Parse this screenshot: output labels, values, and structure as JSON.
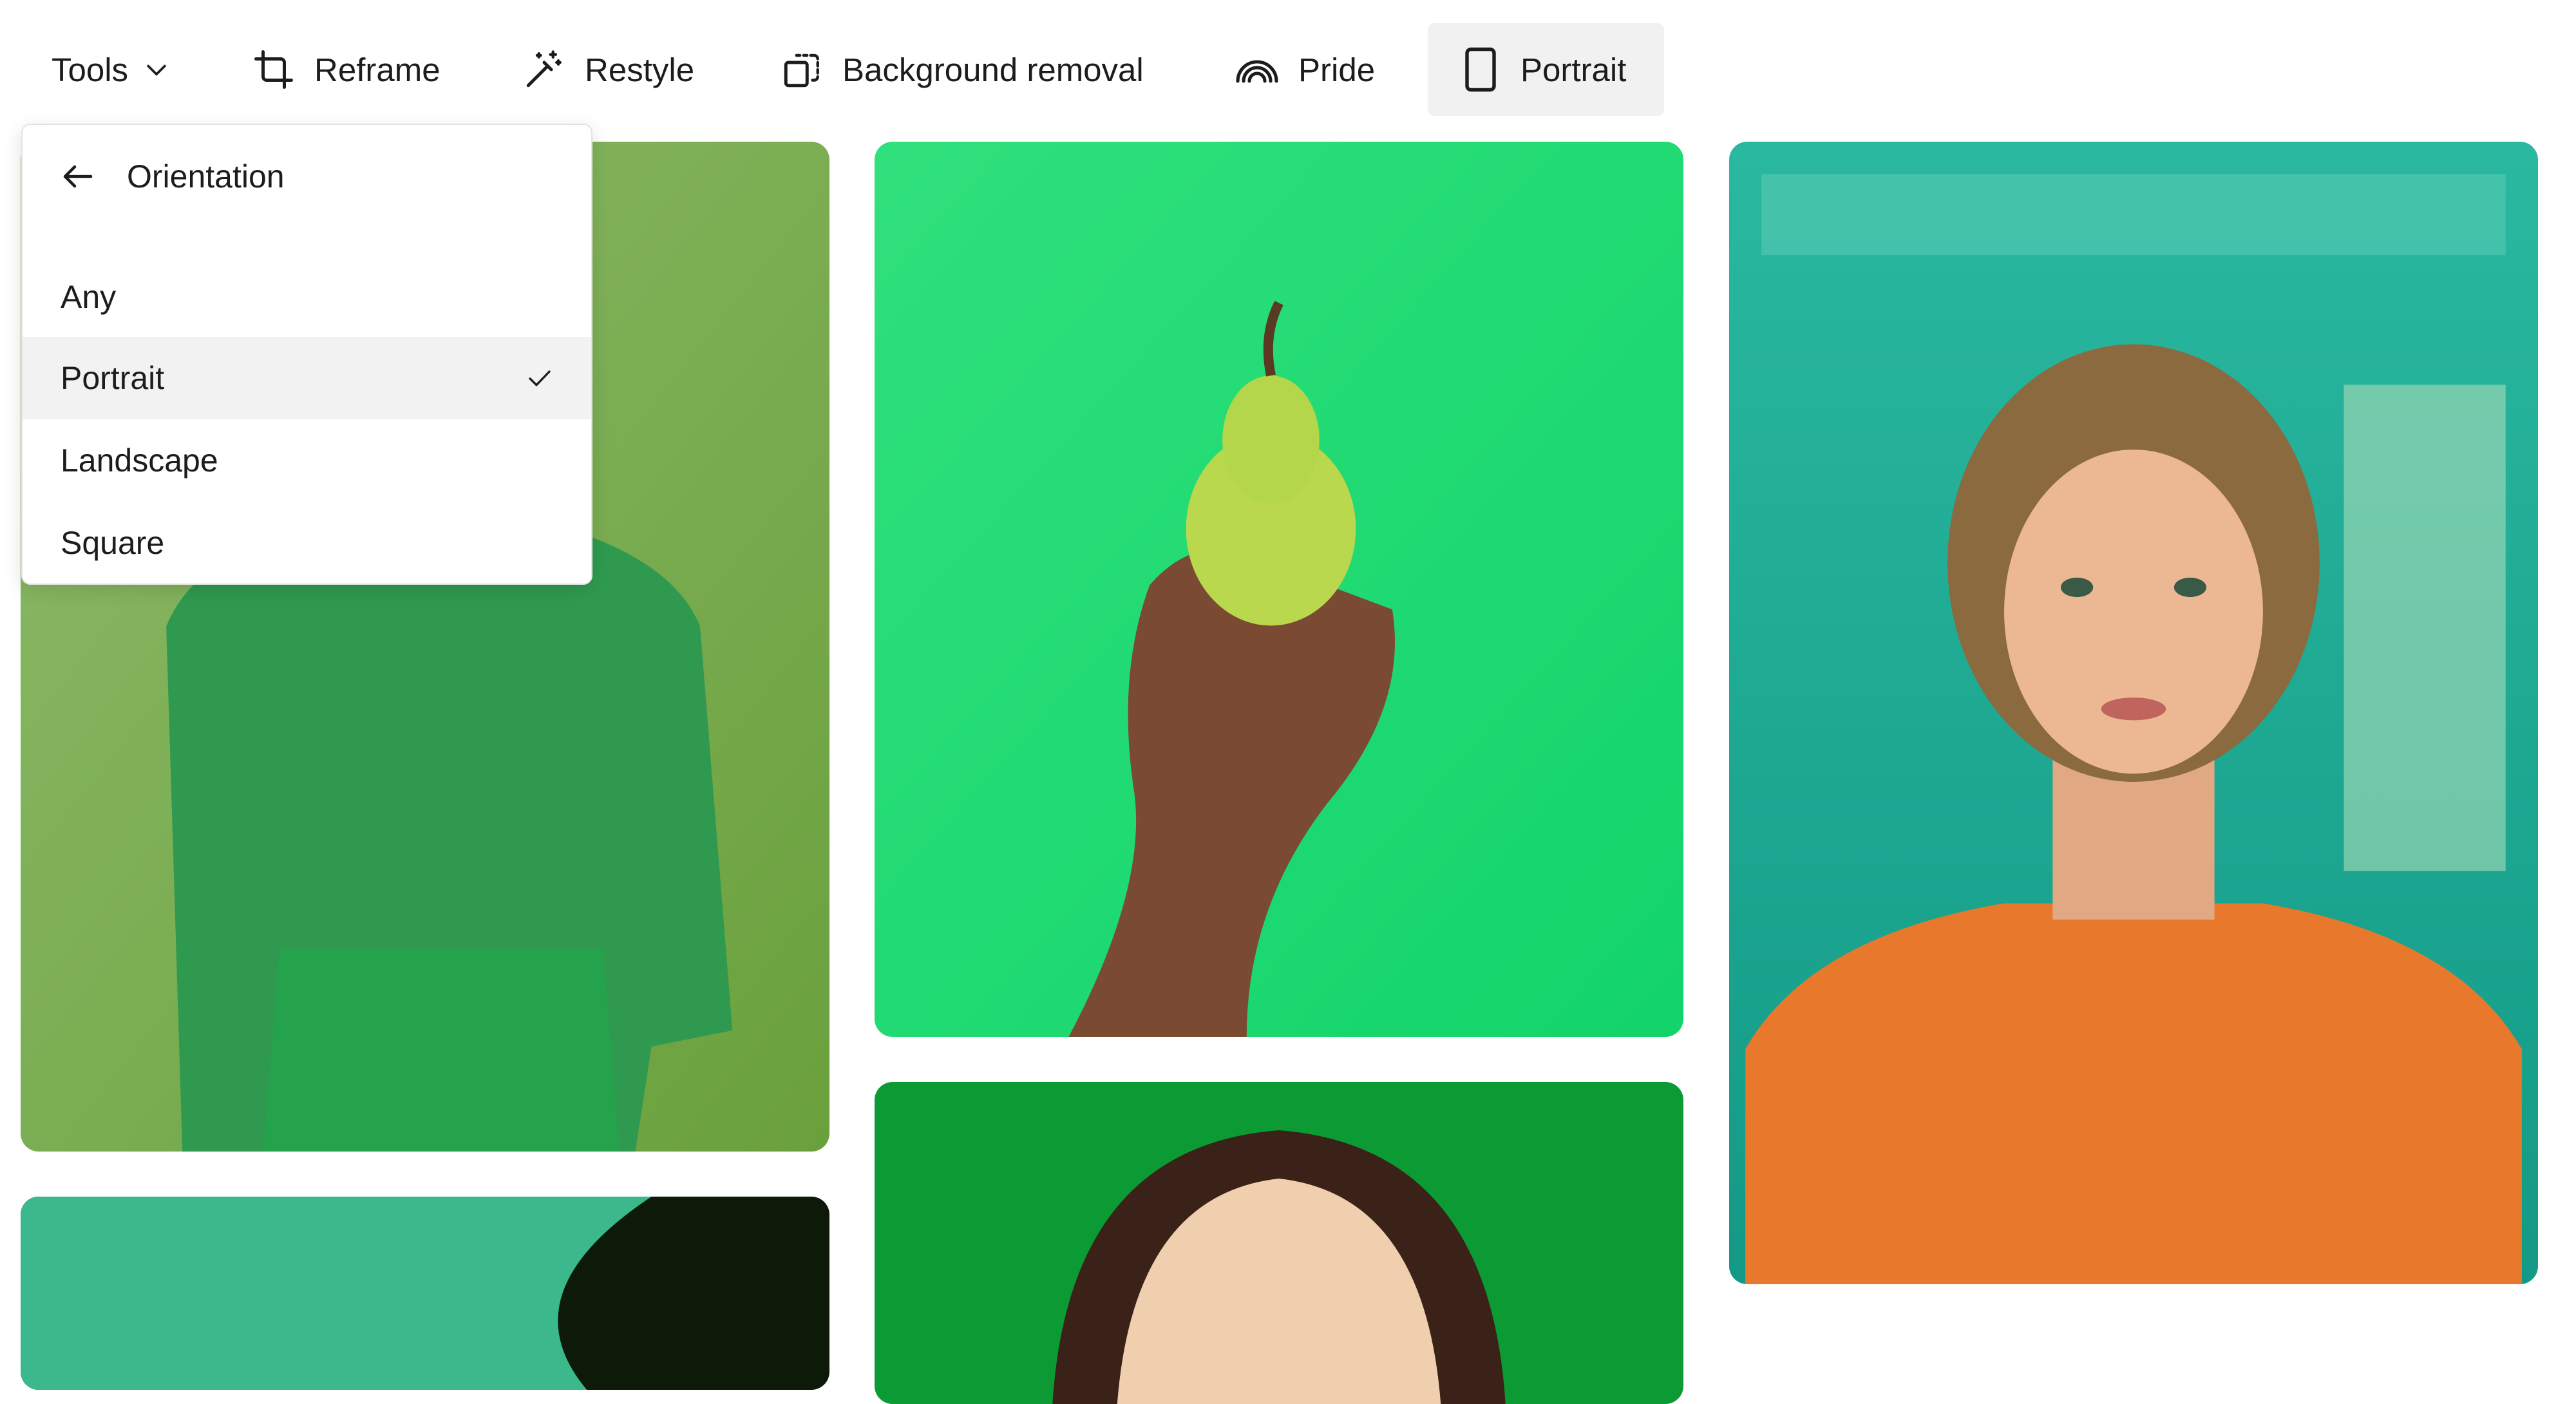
{
  "toolbar": {
    "tools_label": "Tools",
    "reframe_label": "Reframe",
    "restyle_label": "Restyle",
    "bg_removal_label": "Background removal",
    "pride_label": "Pride",
    "portrait_label": "Portrait"
  },
  "orientation_menu": {
    "title": "Orientation",
    "options": [
      {
        "label": "Any",
        "selected": false
      },
      {
        "label": "Portrait",
        "selected": true
      },
      {
        "label": "Landscape",
        "selected": false
      },
      {
        "label": "Square",
        "selected": false
      }
    ]
  },
  "icons": {
    "tools": "chevron-down-icon",
    "reframe": "crop-icon",
    "restyle": "magic-wand-icon",
    "bg_removal": "background-removal-icon",
    "pride": "rainbow-icon",
    "portrait": "portrait-orientation-icon",
    "back": "arrow-left-icon",
    "selected": "checkmark-icon"
  },
  "images": [
    {
      "name": "person-green-sweater",
      "palette": [
        "#86b35e",
        "#2e9c4e"
      ]
    },
    {
      "name": "hand-holding-pear",
      "palette": [
        "#22d86e",
        "#b6d64a"
      ]
    },
    {
      "name": "girl-orange-shirt-teal-room",
      "palette": [
        "#1fb39b",
        "#e97a2c"
      ]
    },
    {
      "name": "teal-dark-abstract",
      "palette": [
        "#39b98a",
        "#0d1a0a"
      ]
    },
    {
      "name": "woman-green-background",
      "palette": [
        "#0b9a34",
        "#f1cfae"
      ]
    }
  ],
  "colors": {
    "active_chip_bg": "#f1f1f1",
    "selected_option_bg": "#f2f2f2",
    "text": "#1c1c1c"
  }
}
